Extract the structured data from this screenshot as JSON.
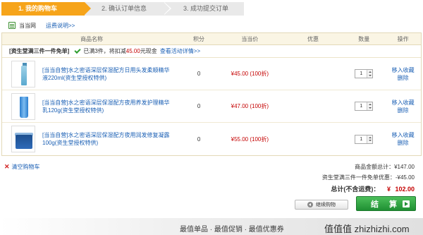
{
  "steps": [
    {
      "label": "1. 我的购物车"
    },
    {
      "label": "2. 确认订单信息"
    },
    {
      "label": "3. 成功提交订单"
    }
  ],
  "shop": {
    "icon": "store-list-icon",
    "name": "当当网",
    "shipping_link": "运费说明>>"
  },
  "table": {
    "headers": {
      "name": "商品名称",
      "points": "积分",
      "price": "当当价",
      "promo": "优惠",
      "qty": "数量",
      "op": "操作"
    },
    "promo": {
      "title": "[资生堂满三件一件免单]",
      "text_before": "已满3件，将扣减",
      "amount": "45.00",
      "text_after": "元现金",
      "link": "查看活动详情>>"
    },
    "items": [
      {
        "name": "[当当自营]水之密语深层保湿配方日用头发柔顺精华液220ml(资生堂授权特供)",
        "points": "0",
        "price": "¥45.00 (100折)",
        "qty": "1",
        "fav": "移入收藏",
        "del": "删除"
      },
      {
        "name": "[当当自营]水之密语深层保湿配方夜用养发护理精华乳120g(资生堂授权特供)",
        "points": "0",
        "price": "¥47.00 (100折)",
        "qty": "1",
        "fav": "移入收藏",
        "del": "删除"
      },
      {
        "name": "[当当自营]水之密语深层保湿配方夜用润发修复凝露100g(资生堂授权特供)",
        "points": "0",
        "price": "¥55.00 (100折)",
        "qty": "1",
        "fav": "移入收藏",
        "del": "删除"
      }
    ]
  },
  "footer": {
    "clear_cart": "清空购物车",
    "subtotal": "商品金额总计：¥147.00",
    "discount": "资生堂满三件一件免单优惠：-¥45.00",
    "total_label": "总计(不含运费)：",
    "total_yen": "¥",
    "total_value": "102.00",
    "continue_label": "继续购物",
    "checkout_label": "结 算"
  },
  "watermark": {
    "tags": "最值单品 · 最值促销 · 最值优惠券",
    "brand": "值值值 zhizhizhi.com"
  },
  "colors": {
    "accent_orange": "#f6a41a",
    "price_red": "#c40000",
    "link_blue": "#1a5fb4",
    "checkout_green": "#1f8f33"
  }
}
